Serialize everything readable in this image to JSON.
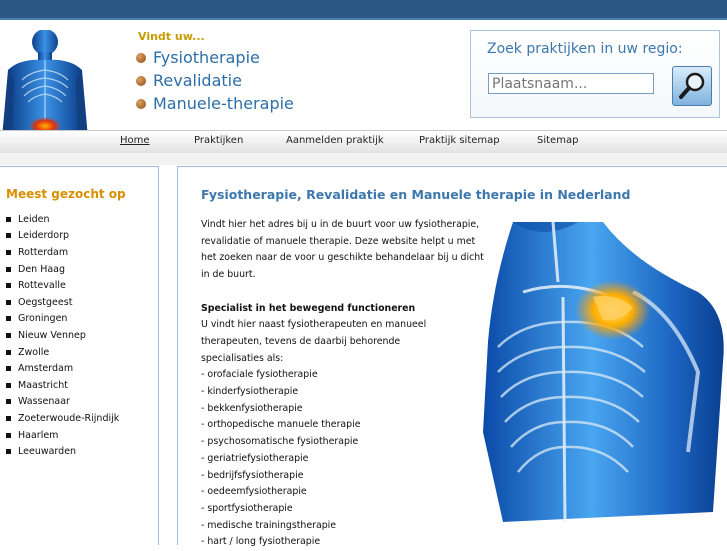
{
  "header": {
    "tagline": "Vindt uw...",
    "links": [
      "Fysiotherapie",
      "Revalidatie",
      "Manuele-therapie"
    ]
  },
  "search": {
    "title": "Zoek praktijken in uw regio:",
    "placeholder": "Plaatsnaam...",
    "button_icon": "magnifier-icon"
  },
  "menu": {
    "items": [
      "Home",
      "Praktijken",
      "Aanmelden praktijk",
      "Praktijk sitemap",
      "Sitemap"
    ]
  },
  "sidebar": {
    "title": "Meest gezocht op",
    "cities": [
      "Leiden",
      "Leiderdorp",
      "Rotterdam",
      "Den Haag",
      "Rottevalle",
      "Oegstgeest",
      "Groningen",
      "Nieuw Vennep",
      "Zwolle",
      "Amsterdam",
      "Maastricht",
      "Wassenaar",
      "Zoeterwoude-Rijndijk",
      "Haarlem",
      "Leeuwarden"
    ]
  },
  "main": {
    "title": "Fysiotherapie, Revalidatie en Manuele therapie in Nederland",
    "intro_lines": [
      "Vindt hier het adres bij u in de buurt voor uw fysiotherapie,",
      "revalidatie of manuele therapie. Deze website helpt u met",
      "het zoeken naar de voor u geschikte behandelaar bij u dicht",
      "in de buurt."
    ],
    "subtitle": "Specialist in het bewegend functioneren",
    "body_lines": [
      "U vindt hier naast fysiotherapeuten en manueel",
      "therapeuten, tevens de daarbij behorende",
      "specialisaties als:"
    ],
    "specializations": [
      "- orofaciale fysiotherapie",
      "- kinderfysiotherapie",
      "- bekkenfysiotherapie",
      "- orthopedische manuele therapie",
      "- psychosomatische fysiotherapie",
      "- geriatriefysiotherapie",
      "- bedrijfsfysiotherapie",
      "- oedeemfysiotherapie",
      "- sportfysiotherapie",
      "- medische trainingstherapie",
      "- hart / long fysiotherapie"
    ]
  },
  "colors": {
    "topbar": "#2a5783",
    "link_blue": "#2c6ea8",
    "accent_orange": "#d89000",
    "tagline_gold": "#c89d00",
    "border_blue": "#9fbcd8"
  }
}
